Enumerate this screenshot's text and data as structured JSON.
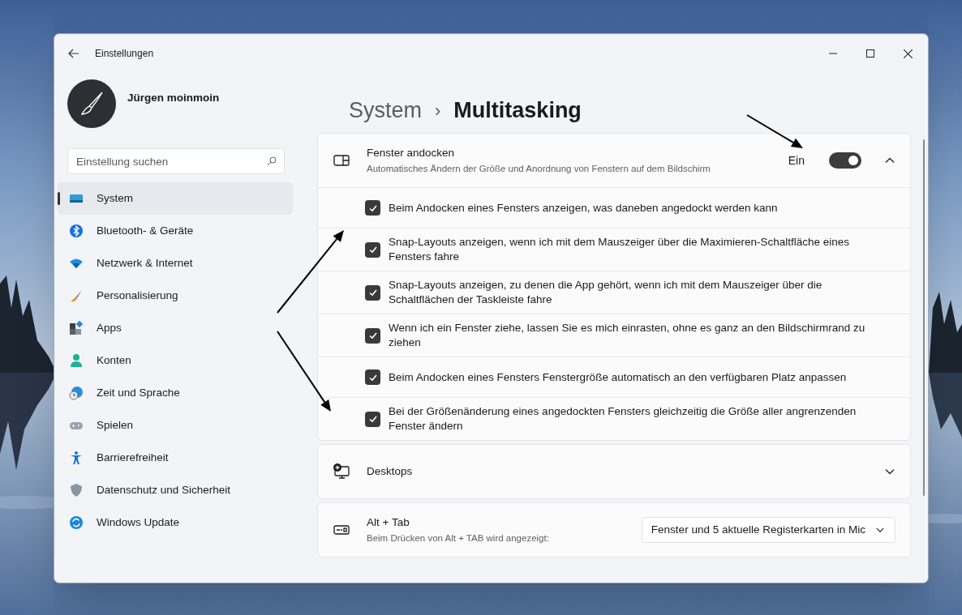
{
  "window": {
    "title": "Einstellungen"
  },
  "user": {
    "name": "Jürgen moinmoin"
  },
  "search": {
    "placeholder": "Einstellung suchen"
  },
  "sidebar": {
    "items": [
      {
        "label": "System",
        "selected": true
      },
      {
        "label": "Bluetooth- & Geräte",
        "selected": false
      },
      {
        "label": "Netzwerk & Internet",
        "selected": false
      },
      {
        "label": "Personalisierung",
        "selected": false
      },
      {
        "label": "Apps",
        "selected": false
      },
      {
        "label": "Konten",
        "selected": false
      },
      {
        "label": "Zeit und Sprache",
        "selected": false
      },
      {
        "label": "Spielen",
        "selected": false
      },
      {
        "label": "Barrierefreiheit",
        "selected": false
      },
      {
        "label": "Datenschutz und Sicherheit",
        "selected": false
      },
      {
        "label": "Windows Update",
        "selected": false
      }
    ]
  },
  "breadcrumb": {
    "parent": "System",
    "separator": "›",
    "current": "Multitasking"
  },
  "sections": [
    {
      "kind": "expander",
      "title": "Fenster andocken",
      "description": "Automatisches Ändern der Größe und Anordnung von Fenstern auf dem Bildschirm",
      "state_label": "Ein",
      "on": true,
      "expanded": true,
      "options": [
        {
          "label": "Beim Andocken eines Fensters anzeigen, was daneben angedockt werden kann",
          "checked": true
        },
        {
          "label": "Snap-Layouts anzeigen, wenn ich mit dem Mauszeiger über die Maximieren-Schaltfläche eines Fensters fahre",
          "checked": true
        },
        {
          "label": "Snap-Layouts anzeigen, zu denen die App gehört, wenn ich mit dem Mauszeiger über die Schaltflächen der Taskleiste fahre",
          "checked": true
        },
        {
          "label": "Wenn ich ein Fenster ziehe, lassen Sie es mich einrasten, ohne es ganz an den Bildschirmrand zu ziehen",
          "checked": true
        },
        {
          "label": "Beim Andocken eines Fensters Fenstergröße automatisch an den verfügbaren Platz anpassen",
          "checked": true
        },
        {
          "label": "Bei der Größenänderung eines angedockten Fensters gleichzeitig die Größe aller angrenzenden Fenster ändern",
          "checked": true
        }
      ]
    },
    {
      "kind": "expander",
      "title": "Desktops",
      "expanded": false
    },
    {
      "kind": "dropdown",
      "title": "Alt + Tab",
      "description": "Beim Drücken von Alt + TAB wird angezeigt:",
      "value": "Fenster und 5 aktuelle Registerkarten in Mic"
    }
  ]
}
